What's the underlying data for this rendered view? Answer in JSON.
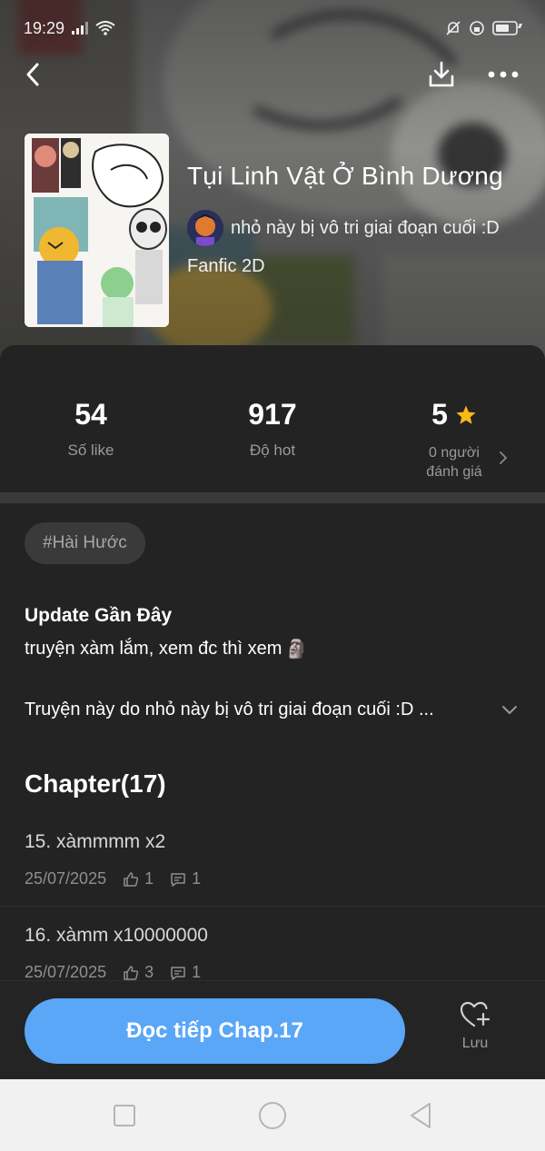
{
  "status_bar": {
    "time": "19:29"
  },
  "story": {
    "title": "Tụi Linh Vật Ở Bình Dương",
    "author": "nhỏ này bị vô tri giai đoạn cuối :D",
    "genre": "Fanfic 2D"
  },
  "stats": {
    "likes": {
      "value": "54",
      "label": "Số like"
    },
    "hot": {
      "value": "917",
      "label": "Độ hot"
    },
    "rating": {
      "value": "5",
      "label_line1": "0 người",
      "label_line2": "đánh giá"
    }
  },
  "tags": [
    "#Hài Hước"
  ],
  "update": {
    "title": "Update Gần Đây",
    "text": "truyện xàm lắm, xem đc thì xem",
    "emoji": "🗿"
  },
  "description": "Truyện này do nhỏ này bị vô tri giai đoạn cuối :D ...",
  "chapters_header": "Chapter(17)",
  "chapters": [
    {
      "title": "15. xàmmmm x2",
      "date": "25/07/2025",
      "likes": "1",
      "comments": "1"
    },
    {
      "title": "16. xàmm x10000000",
      "date": "25/07/2025",
      "likes": "3",
      "comments": "1"
    }
  ],
  "actions": {
    "read_label": "Đọc tiếp Chap.17",
    "save_label": "Lưu"
  },
  "colors": {
    "accent": "#5aa6f7",
    "star": "#f5b918",
    "background": "#232323"
  },
  "icons": {
    "back": "back-arrow-icon",
    "download": "download-icon",
    "more": "more-horizontal-icon",
    "star": "star-icon",
    "like": "thumbs-up-icon",
    "comment": "comment-icon",
    "save": "heart-plus-icon"
  }
}
